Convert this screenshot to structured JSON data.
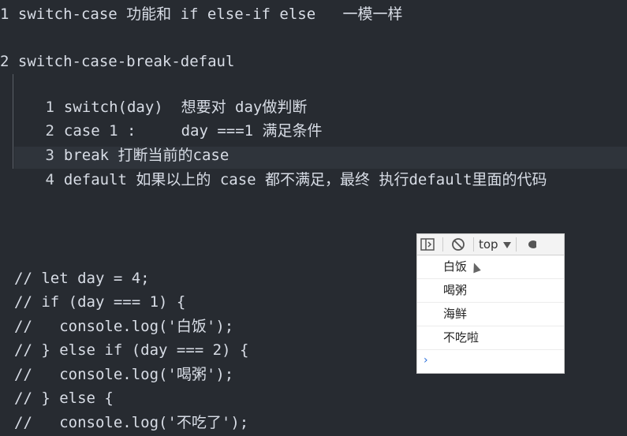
{
  "notes": {
    "line1": "1 switch-case 功能和 if else-if else   一模一样",
    "line2": "2 switch-case-break-defaul",
    "items": [
      {
        "num": "1",
        "text": "switch(day)  想要对 day做判断"
      },
      {
        "num": "2",
        "text": "case 1 :     day ===1 满足条件"
      },
      {
        "num": "3",
        "text": "break 打断当前的case"
      },
      {
        "num": "4",
        "text": "default 如果以上的 case 都不满足，最终 执行default里面的代码"
      }
    ]
  },
  "code_lines": [
    "// let day = 4;",
    "// if (day === 1) {",
    "//   console.log('白饭');",
    "// } else if (day === 2) {",
    "//   console.log('喝粥');",
    "// } else {",
    "//   console.log('不吃了');"
  ],
  "devtools": {
    "context_label": "top",
    "icons": [
      "sidebar-toggle-icon",
      "clear-console-icon",
      "dropdown-arrow-icon",
      "eye-icon"
    ],
    "logs": [
      "白饭",
      "喝粥",
      "海鲜",
      "不吃啦"
    ],
    "prompt_symbol": "›"
  }
}
